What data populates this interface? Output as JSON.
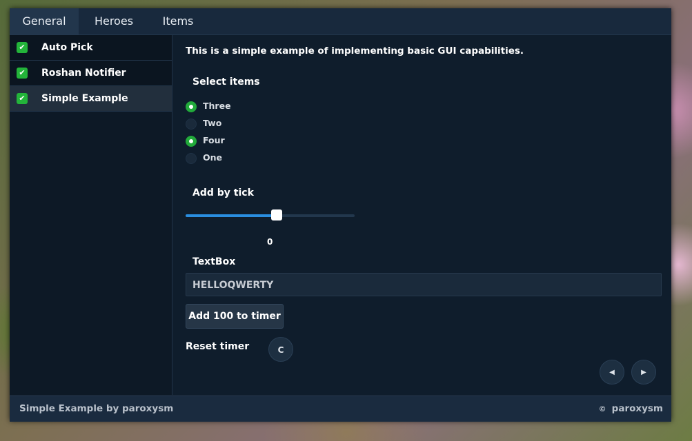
{
  "tabs": [
    {
      "label": "General",
      "active": true
    },
    {
      "label": "Heroes",
      "active": false
    },
    {
      "label": "Items",
      "active": false
    }
  ],
  "sidebar": {
    "items": [
      {
        "label": "Auto Pick",
        "checked": true,
        "active": false
      },
      {
        "label": "Roshan Notifier",
        "checked": true,
        "active": false
      },
      {
        "label": "Simple Example",
        "checked": true,
        "active": true
      }
    ],
    "check_glyph": "✔"
  },
  "main": {
    "description": "This is a simple example of implementing basic GUI capabilities.",
    "select_items": {
      "label": "Select items",
      "options": [
        {
          "label": "Three",
          "selected": true
        },
        {
          "label": "Two",
          "selected": false
        },
        {
          "label": "Four",
          "selected": true
        },
        {
          "label": "One",
          "selected": false
        }
      ]
    },
    "slider": {
      "label": "Add by tick",
      "value_text": "0",
      "fill_fraction": 0.54
    },
    "textbox": {
      "label": "TextBox",
      "value": "HELLOQWERTY"
    },
    "add_button_label": "Add 100 to timer",
    "reset": {
      "label": "Reset timer",
      "button_label": "C"
    },
    "nav": {
      "prev_icon": "◀",
      "next_icon": "▶"
    }
  },
  "footer": {
    "left": "Simple Example by paroxysm",
    "copyright_symbol": "©",
    "right": "paroxysm"
  },
  "colors": {
    "accent_green": "#22aa3b",
    "slider_blue": "#2a8ee0",
    "panel_bg": "#0f1d2c"
  }
}
